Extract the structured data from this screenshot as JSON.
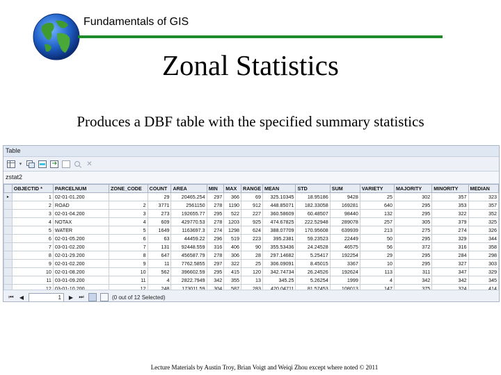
{
  "header": {
    "course": "Fundamentals of GIS",
    "accent_color": "#1d8a2c",
    "logo_icon": "globe-icon"
  },
  "slide": {
    "title": "Zonal Statistics",
    "subtitle": "Produces a DBF table with the specified summary statistics"
  },
  "window": {
    "title": "Table",
    "toolbar_icons": [
      "table-options-icon",
      "dropdown-caret-icon",
      "related-tables-icon",
      "select-by-attributes-icon",
      "switch-selection-icon",
      "clear-selection-icon",
      "zoom-to-selected-icon",
      "delete-selected-icon"
    ],
    "table_name": "zstat2",
    "columns": [
      "OBJECTID *",
      "PARCELNUM",
      "ZONE_CODE",
      "COUNT",
      "AREA",
      "MIN",
      "MAX",
      "RANGE",
      "MEAN",
      "STD",
      "SUM",
      "VARIETY",
      "MAJORITY",
      "MINORITY",
      "MEDIAN"
    ],
    "rows": [
      [
        "1",
        "02-01-01.200",
        "",
        "29",
        "20465.254",
        "297",
        "366",
        "69",
        "325.10345",
        "18.95186",
        "9428",
        "25",
        "302",
        "357",
        "323"
      ],
      [
        "2",
        "ROAD",
        "2",
        "3771",
        "2561150",
        "278",
        "1190",
        "912",
        "448.85071",
        "182.33058",
        "169281",
        "640",
        "295",
        "353",
        "357"
      ],
      [
        "3",
        "02-01-04.200",
        "3",
        "273",
        "192655.77",
        "295",
        "522",
        "227",
        "360.58609",
        "60.48507",
        "98440",
        "132",
        "295",
        "322",
        "352"
      ],
      [
        "4",
        "NOTAX",
        "4",
        "609",
        "429770.53",
        "278",
        "1203",
        "925",
        "474.67825",
        "222.52948",
        "289078",
        "257",
        "305",
        "379",
        "325"
      ],
      [
        "5",
        "WATER",
        "5",
        "1649",
        "1163697.3",
        "274",
        "1298",
        "624",
        "388.07709",
        "170.95608",
        "639939",
        "213",
        "275",
        "274",
        "326"
      ],
      [
        "6",
        "02-01-05.200",
        "6",
        "63",
        "44459.22",
        "296",
        "519",
        "223",
        "395.2381",
        "59.23523",
        "22449",
        "50",
        "295",
        "329",
        "344"
      ],
      [
        "7",
        "03-01-02.200",
        "7",
        "131",
        "92448.559",
        "316",
        "406",
        "90",
        "355.53436",
        "24.24528",
        "46575",
        "56",
        "372",
        "316",
        "358"
      ],
      [
        "8",
        "02-01-29.200",
        "8",
        "647",
        "456587.79",
        "278",
        "306",
        "28",
        "297.14682",
        "5.25417",
        "192254",
        "29",
        "295",
        "284",
        "298"
      ],
      [
        "9",
        "02-01-02.200",
        "9",
        "11",
        "7762.5855",
        "297",
        "322",
        "25",
        "306.09091",
        "8.45015",
        "3367",
        "10",
        "295",
        "327",
        "303"
      ],
      [
        "10",
        "02-01-08.200",
        "10",
        "562",
        "396602.59",
        "295",
        "415",
        "120",
        "342.74734",
        "26.24526",
        "192624",
        "113",
        "311",
        "347",
        "329"
      ],
      [
        "11",
        "03-01-09.200",
        "11",
        "4",
        "2822.7949",
        "342",
        "355",
        "13",
        "345.25",
        "5.26254",
        "1999",
        "4",
        "342",
        "342",
        "345"
      ],
      [
        "12",
        "03-01-10.200",
        "12",
        "248",
        "173011.59",
        "304",
        "587",
        "283",
        "420.04711",
        "81.57453",
        "108013",
        "147",
        "375",
        "324",
        "414"
      ]
    ],
    "status": {
      "record_number": "1",
      "selection_text": "(0 out of 12 Selected)",
      "tab_label": "zstat2"
    }
  }
}
